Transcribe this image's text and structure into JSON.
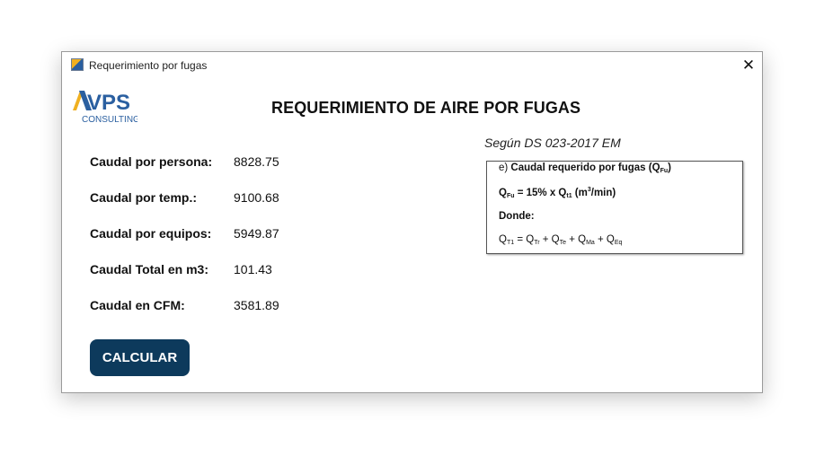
{
  "window": {
    "title": "Requerimiento por fugas",
    "close_glyph": "✕"
  },
  "logo": {
    "brand": "VPS",
    "sub": "CONSULTING"
  },
  "heading": "REQUERIMIENTO DE AIRE POR FUGAS",
  "fields": [
    {
      "label": "Caudal por persona:",
      "value": "8828.75"
    },
    {
      "label": "Caudal por temp.:",
      "value": "9100.68"
    },
    {
      "label": "Caudal por equipos:",
      "value": "5949.87"
    },
    {
      "label": "Caudal Total en m3:",
      "value": "101.43"
    },
    {
      "label": "Caudal en CFM:",
      "value": "3581.89"
    }
  ],
  "calculate_label": "CALCULAR",
  "reference_note": "Según DS 023-2017 EM",
  "formula": {
    "line1_prefix": "e) ",
    "line1_bold": "Caudal requerido por fugas (Q",
    "line1_sub": "Fu",
    "line1_end": ")",
    "line2_q": "Q",
    "line2_sub1": "Fu",
    "line2_mid": " = 15% x Q",
    "line2_sub2": "t1",
    "line2_unit_a": " (m",
    "line2_sup": "3",
    "line2_unit_b": "/min)",
    "line3": "Donde:",
    "line4_q1": "Q",
    "line4_s1": "T1",
    "line4_q2": " = Q",
    "line4_s2": "Tr",
    "line4_q3": " + Q",
    "line4_s3": "Te",
    "line4_q4": " + Q",
    "line4_s4": "Ma",
    "line4_q5": " + Q",
    "line4_s5": "Eq"
  },
  "colors": {
    "primary": "#0d3a5c",
    "logo_accent": "#f0b020",
    "logo_blue": "#2a5fa0"
  }
}
